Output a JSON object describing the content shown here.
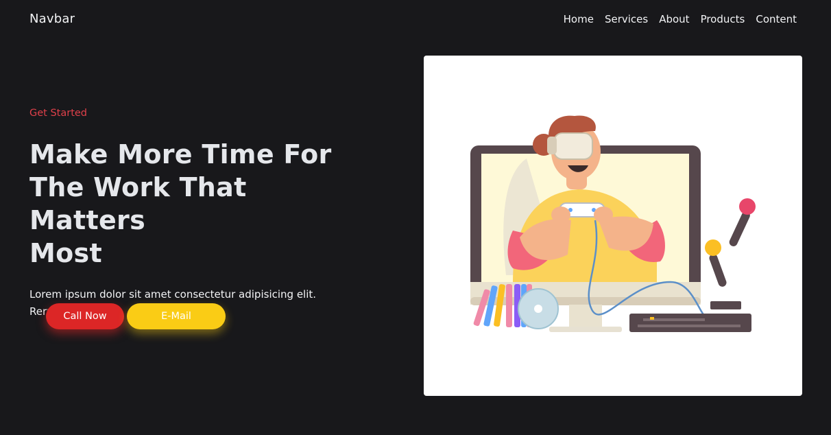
{
  "navbar": {
    "brand": "Navbar",
    "links": [
      "Home",
      "Services",
      "About",
      "Products",
      "Content"
    ]
  },
  "hero": {
    "eyebrow": "Get Started",
    "headline_lines": [
      "Make More Time For",
      "The Work That Matters",
      "Most"
    ],
    "lead": "Lorem ipsum dolor sit amet consectetur adipisicing elit. Rerum, corrupti!",
    "buttons": {
      "call": "Call Now",
      "email": "E-Mail"
    }
  },
  "colors": {
    "background": "#18181b",
    "accent_red": "#dc2626",
    "accent_yellow": "#facc15",
    "eyebrow": "#e0404a"
  },
  "illustration": {
    "icon": "vr-gamer-illustration"
  }
}
